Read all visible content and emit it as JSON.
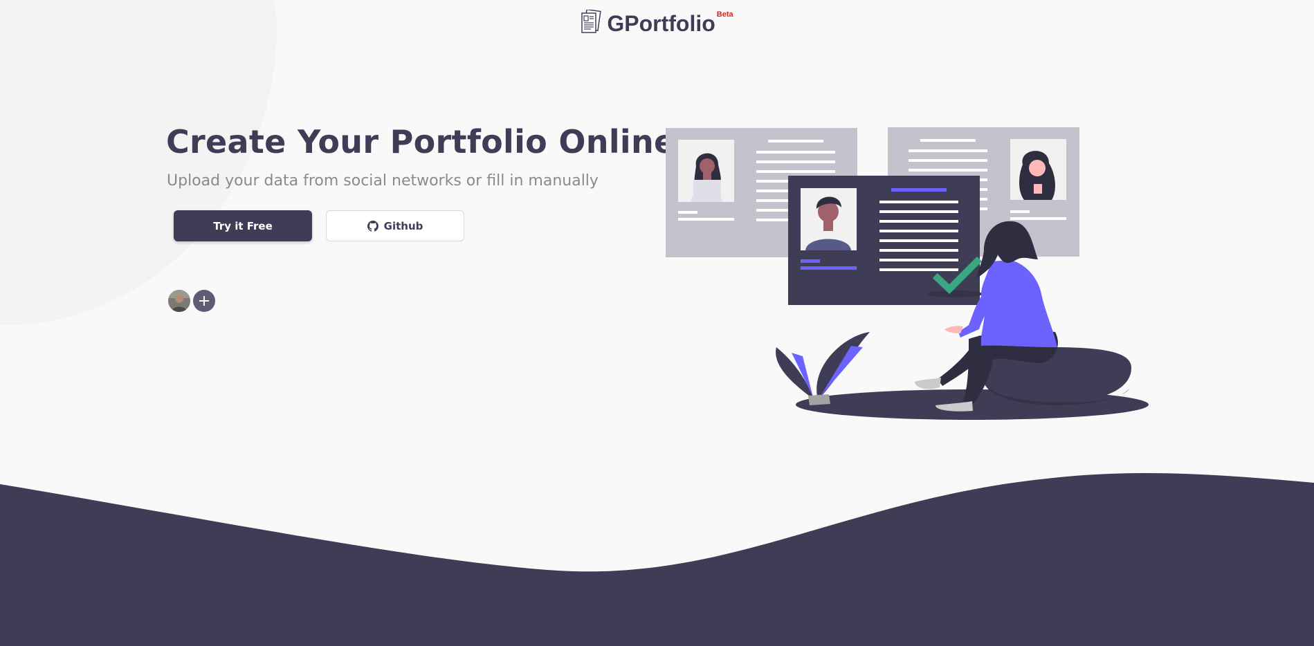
{
  "header": {
    "brand_name": "GPortfolio",
    "beta_label": "Beta",
    "logo_icon": "document-stack-icon"
  },
  "hero": {
    "title": "Create Your Portfolio Online",
    "subtitle": "Upload your data from social networks or fill in manually",
    "primary_button": "Try it Free",
    "secondary_button": "Github",
    "secondary_icon": "github-icon"
  },
  "users": {
    "add_icon": "plus-icon"
  },
  "colors": {
    "primary": "#3f3d56",
    "accent": "#6c63ff",
    "success": "#3ba780",
    "beta": "#e02020",
    "background": "#f9f9f9"
  }
}
